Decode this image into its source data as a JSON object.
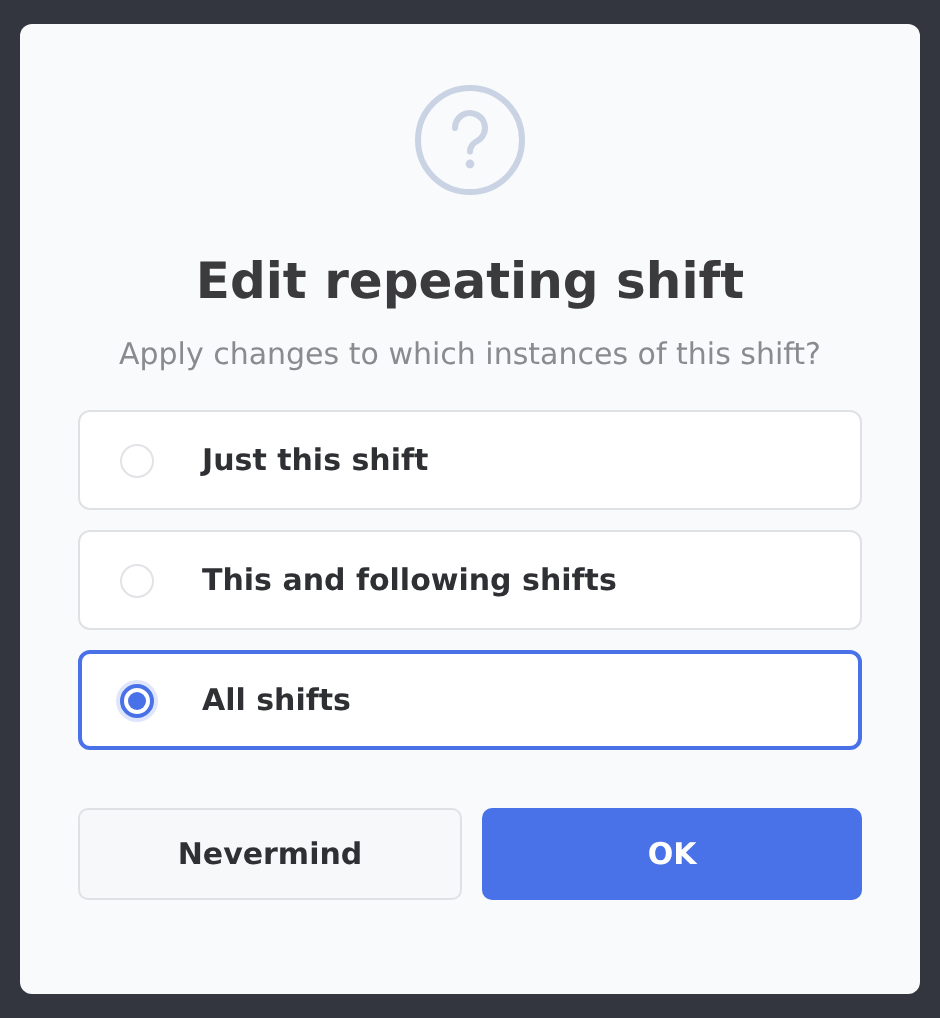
{
  "dialog": {
    "title": "Edit repeating shift",
    "subtitle": "Apply changes to which instances of this shift?",
    "options": [
      {
        "label": "Just this shift",
        "selected": false
      },
      {
        "label": "This and following shifts",
        "selected": false
      },
      {
        "label": "All shifts",
        "selected": true
      }
    ],
    "buttons": [
      {
        "label": "Nevermind",
        "kind": "secondary"
      },
      {
        "label": "OK",
        "kind": "primary"
      }
    ]
  }
}
